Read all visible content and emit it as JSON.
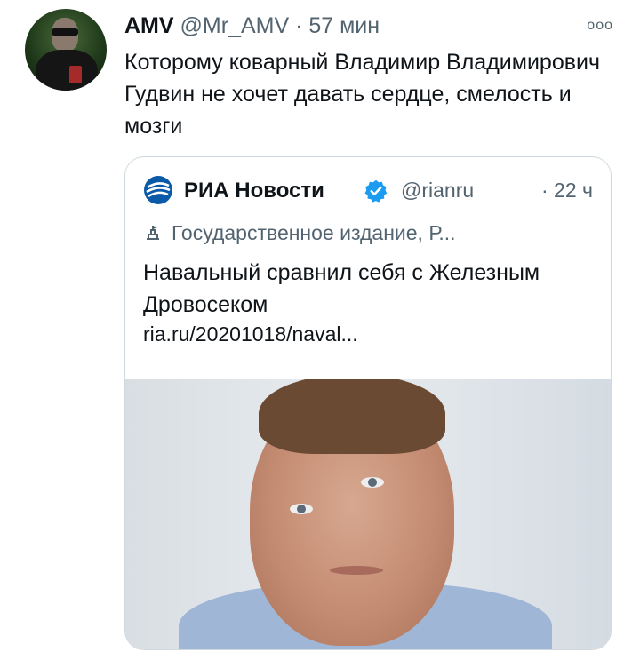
{
  "tweet": {
    "author_name": "AMV",
    "author_handle": "@Mr_AMV",
    "separator": "·",
    "time": "57 мин",
    "more": "ооо",
    "text": "Которому коварный Владимир Владимирович Гудвин не хочет давать сердце, смелость и мозги"
  },
  "quote": {
    "author_name": "РИА Новости",
    "author_handle": "@rianru",
    "time": "· 22 ч",
    "label": "Государственное издание, Р...",
    "text": "Навальный сравнил себя с Железным Дровосеком",
    "link": "ria.ru/20201018/naval..."
  },
  "colors": {
    "text": "#0f1419",
    "secondary": "#536471",
    "border": "#cfd9de",
    "verified": "#1d9bf0",
    "ria_blue": "#0a5aa8"
  },
  "icons": {
    "more": "more-dots-icon",
    "verified": "verified-badge-icon",
    "label": "state-media-icon",
    "logo": "ria-logo-icon"
  }
}
